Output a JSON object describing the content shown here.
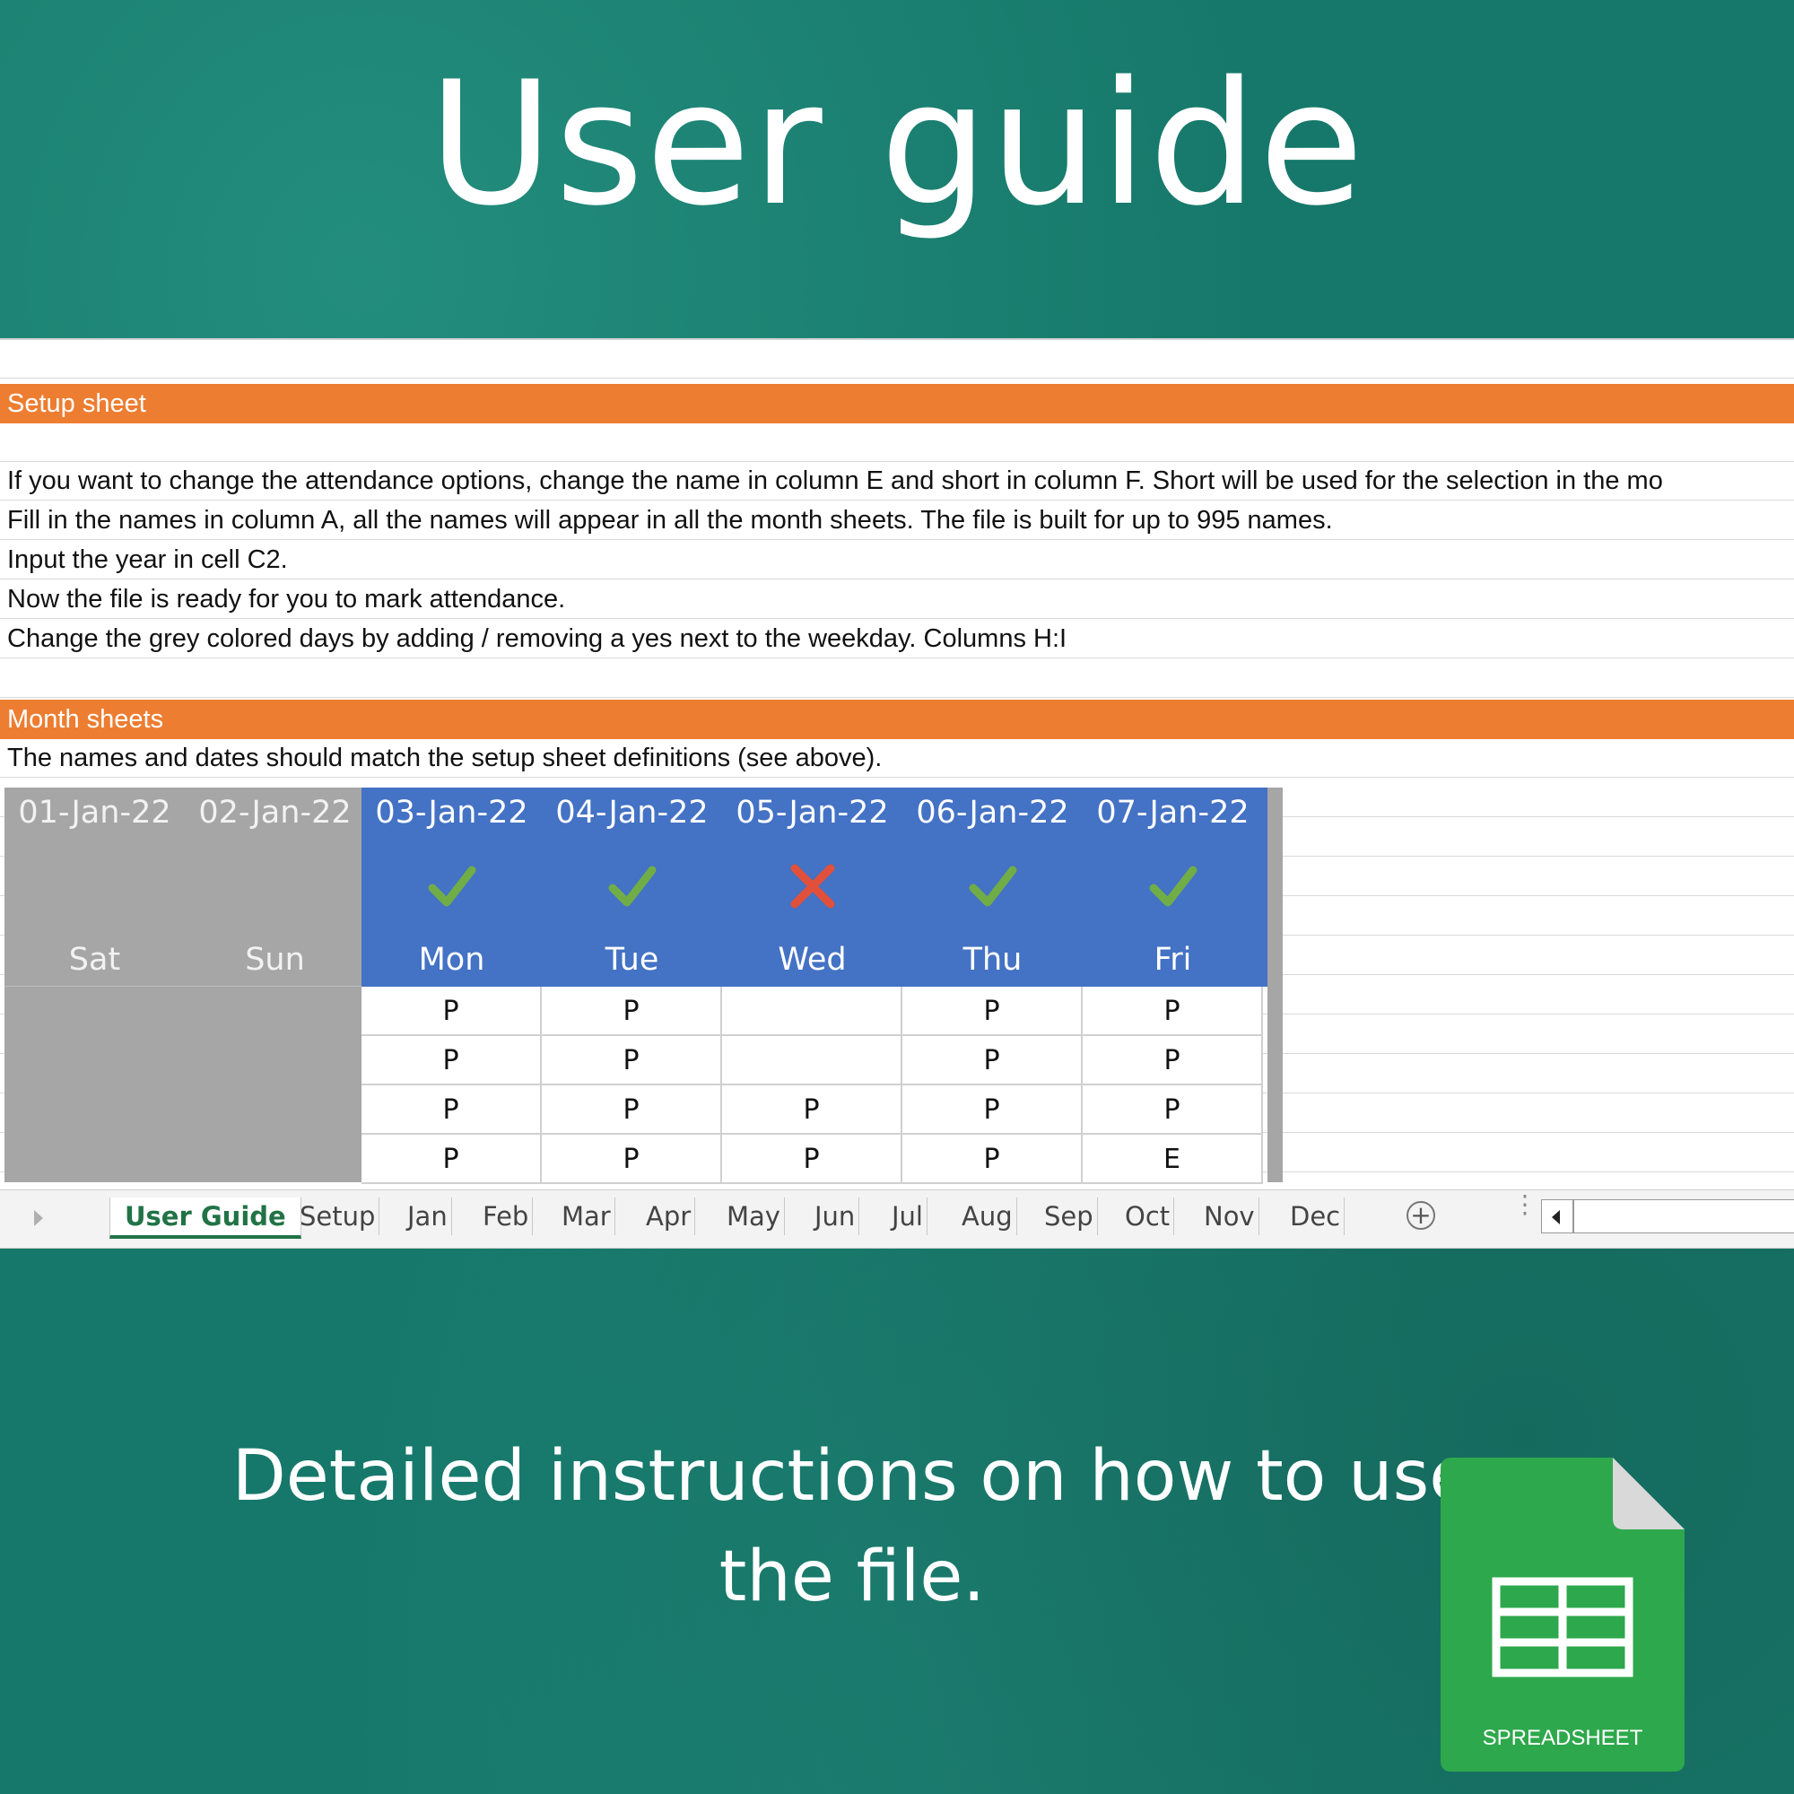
{
  "hero": {
    "title": "User guide"
  },
  "sheet": {
    "setup_header": "Setup sheet",
    "setup_lines": [
      "If you want to change the attendance options, change the name in column E and short in column F. Short will be used for the selection in the mo",
      "Fill in the names in column A, all the names will appear in all the month sheets. The file is built for up to 995 names.",
      "Input the year in cell C2.",
      "Now the file is ready for you to mark attendance.",
      "Change the grey colored days by adding / removing a yes next to the weekday. Columns H:I"
    ],
    "month_header": "Month sheets",
    "month_line": "The names and dates should match the setup sheet definitions (see above)."
  },
  "attendance": {
    "columns": [
      {
        "date": "01-Jan-22",
        "day": "Sat",
        "status": "weekend"
      },
      {
        "date": "02-Jan-22",
        "day": "Sun",
        "status": "weekend"
      },
      {
        "date": "03-Jan-22",
        "day": "Mon",
        "status": "check"
      },
      {
        "date": "04-Jan-22",
        "day": "Tue",
        "status": "check"
      },
      {
        "date": "05-Jan-22",
        "day": "Wed",
        "status": "cross"
      },
      {
        "date": "06-Jan-22",
        "day": "Thu",
        "status": "check"
      },
      {
        "date": "07-Jan-22",
        "day": "Fri",
        "status": "check"
      }
    ],
    "rows": [
      [
        "P",
        "P",
        "",
        "P",
        "P"
      ],
      [
        "P",
        "P",
        "",
        "P",
        "P"
      ],
      [
        "P",
        "P",
        "P",
        "P",
        "P"
      ],
      [
        "P",
        "P",
        "P",
        "P",
        "E"
      ]
    ],
    "colors": {
      "check": "#70ad47",
      "cross": "#e0503a",
      "header_blue": "#4472c4",
      "weekend_grey": "#a6a6a6"
    }
  },
  "tabs": {
    "active": "User Guide",
    "items": [
      "Setup",
      "Jan",
      "Feb",
      "Mar",
      "Apr",
      "May",
      "Jun",
      "Jul",
      "Aug",
      "Sep",
      "Oct",
      "Nov",
      "Dec"
    ]
  },
  "bottom": {
    "line1": "Detailed instructions on how to use",
    "line2": "the file."
  },
  "file_icon": {
    "label": "SPREADSHEET",
    "color": "#2ea84c"
  }
}
